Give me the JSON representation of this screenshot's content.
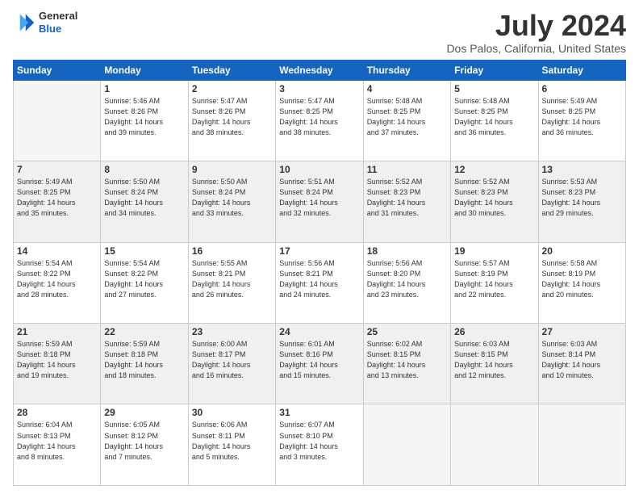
{
  "logo": {
    "line1": "General",
    "line2": "Blue"
  },
  "title": "July 2024",
  "subtitle": "Dos Palos, California, United States",
  "headers": [
    "Sunday",
    "Monday",
    "Tuesday",
    "Wednesday",
    "Thursday",
    "Friday",
    "Saturday"
  ],
  "weeks": [
    [
      {
        "day": "",
        "info": ""
      },
      {
        "day": "1",
        "info": "Sunrise: 5:46 AM\nSunset: 8:26 PM\nDaylight: 14 hours\nand 39 minutes."
      },
      {
        "day": "2",
        "info": "Sunrise: 5:47 AM\nSunset: 8:26 PM\nDaylight: 14 hours\nand 38 minutes."
      },
      {
        "day": "3",
        "info": "Sunrise: 5:47 AM\nSunset: 8:25 PM\nDaylight: 14 hours\nand 38 minutes."
      },
      {
        "day": "4",
        "info": "Sunrise: 5:48 AM\nSunset: 8:25 PM\nDaylight: 14 hours\nand 37 minutes."
      },
      {
        "day": "5",
        "info": "Sunrise: 5:48 AM\nSunset: 8:25 PM\nDaylight: 14 hours\nand 36 minutes."
      },
      {
        "day": "6",
        "info": "Sunrise: 5:49 AM\nSunset: 8:25 PM\nDaylight: 14 hours\nand 36 minutes."
      }
    ],
    [
      {
        "day": "7",
        "info": "Sunrise: 5:49 AM\nSunset: 8:25 PM\nDaylight: 14 hours\nand 35 minutes."
      },
      {
        "day": "8",
        "info": "Sunrise: 5:50 AM\nSunset: 8:24 PM\nDaylight: 14 hours\nand 34 minutes."
      },
      {
        "day": "9",
        "info": "Sunrise: 5:50 AM\nSunset: 8:24 PM\nDaylight: 14 hours\nand 33 minutes."
      },
      {
        "day": "10",
        "info": "Sunrise: 5:51 AM\nSunset: 8:24 PM\nDaylight: 14 hours\nand 32 minutes."
      },
      {
        "day": "11",
        "info": "Sunrise: 5:52 AM\nSunset: 8:23 PM\nDaylight: 14 hours\nand 31 minutes."
      },
      {
        "day": "12",
        "info": "Sunrise: 5:52 AM\nSunset: 8:23 PM\nDaylight: 14 hours\nand 30 minutes."
      },
      {
        "day": "13",
        "info": "Sunrise: 5:53 AM\nSunset: 8:23 PM\nDaylight: 14 hours\nand 29 minutes."
      }
    ],
    [
      {
        "day": "14",
        "info": "Sunrise: 5:54 AM\nSunset: 8:22 PM\nDaylight: 14 hours\nand 28 minutes."
      },
      {
        "day": "15",
        "info": "Sunrise: 5:54 AM\nSunset: 8:22 PM\nDaylight: 14 hours\nand 27 minutes."
      },
      {
        "day": "16",
        "info": "Sunrise: 5:55 AM\nSunset: 8:21 PM\nDaylight: 14 hours\nand 26 minutes."
      },
      {
        "day": "17",
        "info": "Sunrise: 5:56 AM\nSunset: 8:21 PM\nDaylight: 14 hours\nand 24 minutes."
      },
      {
        "day": "18",
        "info": "Sunrise: 5:56 AM\nSunset: 8:20 PM\nDaylight: 14 hours\nand 23 minutes."
      },
      {
        "day": "19",
        "info": "Sunrise: 5:57 AM\nSunset: 8:19 PM\nDaylight: 14 hours\nand 22 minutes."
      },
      {
        "day": "20",
        "info": "Sunrise: 5:58 AM\nSunset: 8:19 PM\nDaylight: 14 hours\nand 20 minutes."
      }
    ],
    [
      {
        "day": "21",
        "info": "Sunrise: 5:59 AM\nSunset: 8:18 PM\nDaylight: 14 hours\nand 19 minutes."
      },
      {
        "day": "22",
        "info": "Sunrise: 5:59 AM\nSunset: 8:18 PM\nDaylight: 14 hours\nand 18 minutes."
      },
      {
        "day": "23",
        "info": "Sunrise: 6:00 AM\nSunset: 8:17 PM\nDaylight: 14 hours\nand 16 minutes."
      },
      {
        "day": "24",
        "info": "Sunrise: 6:01 AM\nSunset: 8:16 PM\nDaylight: 14 hours\nand 15 minutes."
      },
      {
        "day": "25",
        "info": "Sunrise: 6:02 AM\nSunset: 8:15 PM\nDaylight: 14 hours\nand 13 minutes."
      },
      {
        "day": "26",
        "info": "Sunrise: 6:03 AM\nSunset: 8:15 PM\nDaylight: 14 hours\nand 12 minutes."
      },
      {
        "day": "27",
        "info": "Sunrise: 6:03 AM\nSunset: 8:14 PM\nDaylight: 14 hours\nand 10 minutes."
      }
    ],
    [
      {
        "day": "28",
        "info": "Sunrise: 6:04 AM\nSunset: 8:13 PM\nDaylight: 14 hours\nand 8 minutes."
      },
      {
        "day": "29",
        "info": "Sunrise: 6:05 AM\nSunset: 8:12 PM\nDaylight: 14 hours\nand 7 minutes."
      },
      {
        "day": "30",
        "info": "Sunrise: 6:06 AM\nSunset: 8:11 PM\nDaylight: 14 hours\nand 5 minutes."
      },
      {
        "day": "31",
        "info": "Sunrise: 6:07 AM\nSunset: 8:10 PM\nDaylight: 14 hours\nand 3 minutes."
      },
      {
        "day": "",
        "info": ""
      },
      {
        "day": "",
        "info": ""
      },
      {
        "day": "",
        "info": ""
      }
    ]
  ]
}
